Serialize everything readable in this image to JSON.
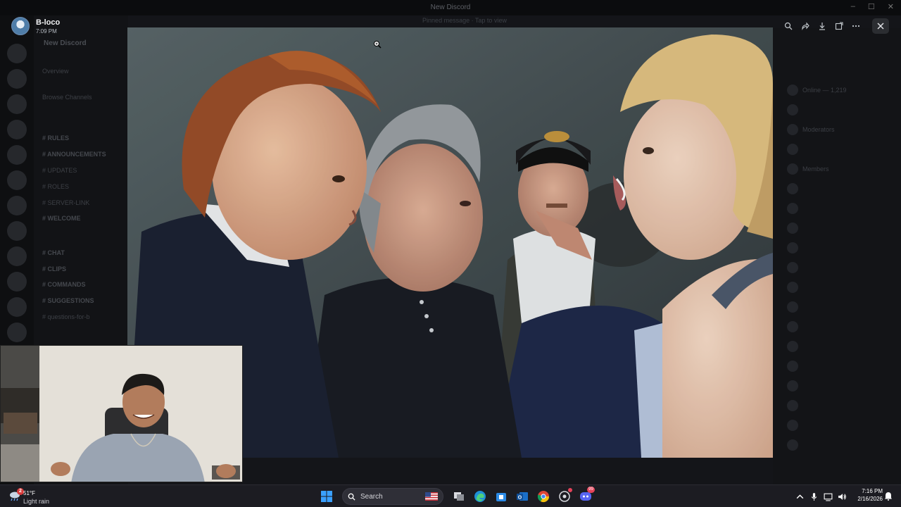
{
  "window": {
    "title": "New Discord",
    "controls": [
      "–",
      "☐",
      "✕"
    ]
  },
  "discord": {
    "banner_text": "Pinned message · Tap to view",
    "server_name": "New Discord",
    "channels": [
      {
        "label": "Overview",
        "bold": false
      },
      {
        "label": "Browse Channels",
        "bold": false
      },
      {
        "label": "# RULES",
        "bold": true
      },
      {
        "label": "# ANNOUNCEMENTS",
        "bold": true
      },
      {
        "label": "# UPDATES",
        "bold": false
      },
      {
        "label": "# ROLES",
        "bold": false
      },
      {
        "label": "# SERVER-LINK",
        "bold": false
      },
      {
        "label": "# WELCOME",
        "bold": true
      },
      {
        "label": "# CHAT",
        "bold": true
      },
      {
        "label": "# CLIPS",
        "bold": true
      },
      {
        "label": "# COMMANDS",
        "bold": true
      },
      {
        "label": "# SUGGESTIONS",
        "bold": true
      },
      {
        "label": "# questions-for-b",
        "bold": false
      }
    ],
    "members": [
      "Online — 1,219",
      "",
      "Moderators",
      "",
      "Members",
      "",
      "",
      "",
      "",
      "",
      "",
      "",
      "",
      "",
      "",
      "",
      "",
      "",
      ""
    ]
  },
  "viewer": {
    "uploader_name": "B-loco",
    "upload_time": "7:09 PM",
    "tools": [
      {
        "name": "zoom-icon"
      },
      {
        "name": "forward-icon"
      },
      {
        "name": "download-icon"
      },
      {
        "name": "open-external-icon"
      },
      {
        "name": "more-icon"
      }
    ],
    "close_icon": "close-icon"
  },
  "taskbar": {
    "weather_temp": "51°F",
    "weather_desc": "Light rain",
    "weather_badge": "2",
    "search_placeholder": "Search",
    "discord_badge": "99",
    "time": "7:16 PM",
    "date": "2/16/2026",
    "apps": [
      "windows-start-icon",
      "task-view-icon",
      "edge-icon",
      "store-icon",
      "outlook-icon",
      "chrome-icon",
      "extensions-icon",
      "discord-icon"
    ]
  },
  "colors": {
    "discord_bg": "#141519",
    "taskbar_bg": "#1c1c22",
    "accent": "#5865f2"
  }
}
